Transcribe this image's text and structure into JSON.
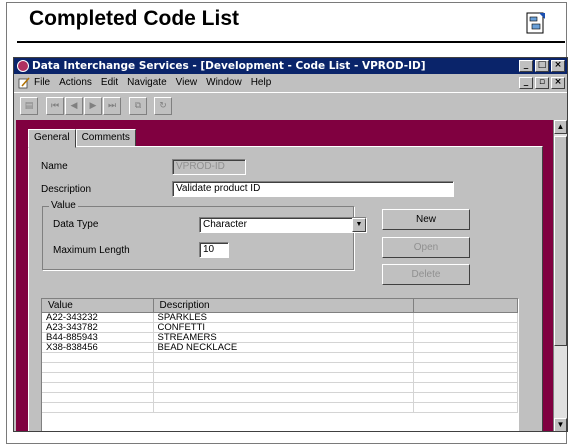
{
  "slide": {
    "title": "Completed Code List"
  },
  "window": {
    "title": "Data Interchange Services - [Development - Code List - VPROD-ID]"
  },
  "menu": [
    "File",
    "Actions",
    "Edit",
    "Navigate",
    "View",
    "Window",
    "Help"
  ],
  "toolbar": {
    "buttons": [
      "save-icon",
      "first-icon",
      "previous-icon",
      "next-icon",
      "last-icon",
      "copy-icon",
      "refresh-icon"
    ]
  },
  "tabs": [
    {
      "label": "General",
      "active": true
    },
    {
      "label": "Comments",
      "active": false
    }
  ],
  "form": {
    "name_label": "Name",
    "name_value": "VPROD-ID",
    "description_label": "Description",
    "description_value": "Validate product ID",
    "value_group_label": "Value",
    "data_type_label": "Data Type",
    "data_type_value": "Character",
    "max_length_label": "Maximum Length",
    "max_length_value": "10"
  },
  "buttons": {
    "new": "New",
    "open": "Open",
    "delete": "Delete"
  },
  "grid": {
    "columns": [
      "Value",
      "Description"
    ],
    "rows": [
      [
        "A22-343232",
        "SPARKLES"
      ],
      [
        "A23-343782",
        "CONFETTI"
      ],
      [
        "B44-885943",
        "STREAMERS"
      ],
      [
        "X38-838456",
        "BEAD NECKLACE"
      ],
      [
        "",
        ""
      ],
      [
        "",
        ""
      ],
      [
        "",
        ""
      ],
      [
        "",
        ""
      ],
      [
        "",
        ""
      ],
      [
        "",
        ""
      ]
    ]
  },
  "colors": {
    "workspace": "#800040",
    "titlebar": "#0a246a",
    "chrome": "#c0c0c0"
  }
}
